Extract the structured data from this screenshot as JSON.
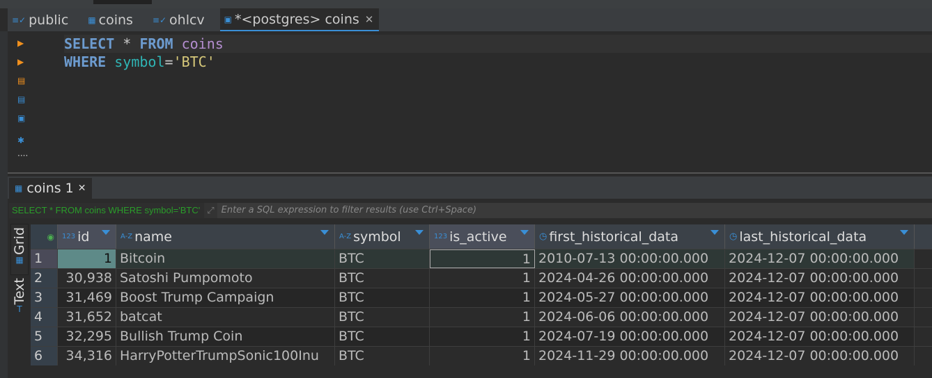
{
  "editor_tabs": [
    {
      "label": "public",
      "icon": "schema-icon"
    },
    {
      "label": "coins",
      "icon": "table-icon"
    },
    {
      "label": "ohlcv",
      "icon": "schema-icon"
    },
    {
      "label": "*<postgres> coins",
      "icon": "sql-console-icon",
      "active": true
    }
  ],
  "sql": {
    "l1_kw1": "SELECT",
    "l1_star": " * ",
    "l1_kw2": "FROM",
    "l1_table": " coins",
    "l2_kw": "WHERE",
    "l2_col": " symbol",
    "l2_op": "=",
    "l2_str": "'BTC'"
  },
  "results_tab": {
    "label": "coins 1"
  },
  "filter": {
    "query": "SELECT * FROM coins WHERE symbol='BTC'",
    "placeholder": "Enter a SQL expression to filter results (use Ctrl+Space)"
  },
  "side_tabs": {
    "grid": "Grid",
    "text": "Text"
  },
  "columns": [
    {
      "label": "id",
      "type": "123"
    },
    {
      "label": "name",
      "type": "A-Z"
    },
    {
      "label": "symbol",
      "type": "A-Z"
    },
    {
      "label": "is_active",
      "type": "123"
    },
    {
      "label": "first_historical_data",
      "type": "clock"
    },
    {
      "label": "last_historical_data",
      "type": "clock"
    }
  ],
  "rows": [
    [
      "1",
      "1",
      "Bitcoin",
      "BTC",
      "1",
      "2010-07-13 00:00:00.000",
      "2024-12-07 00:00:00.000"
    ],
    [
      "2",
      "30,938",
      "Satoshi Pumpomoto",
      "BTC",
      "1",
      "2024-04-26 00:00:00.000",
      "2024-12-07 00:00:00.000"
    ],
    [
      "3",
      "31,469",
      "Boost Trump Campaign",
      "BTC",
      "1",
      "2024-05-27 00:00:00.000",
      "2024-12-07 00:00:00.000"
    ],
    [
      "4",
      "31,652",
      "batcat",
      "BTC",
      "1",
      "2024-06-06 00:00:00.000",
      "2024-12-07 00:00:00.000"
    ],
    [
      "5",
      "32,295",
      "Bullish Trump Coin",
      "BTC",
      "1",
      "2024-07-19 00:00:00.000",
      "2024-12-07 00:00:00.000"
    ],
    [
      "6",
      "34,316",
      "HarryPotterTrumpSonic100Inu",
      "BTC",
      "1",
      "2024-11-29 00:00:00.000",
      "2024-12-07 00:00:00.000"
    ]
  ]
}
